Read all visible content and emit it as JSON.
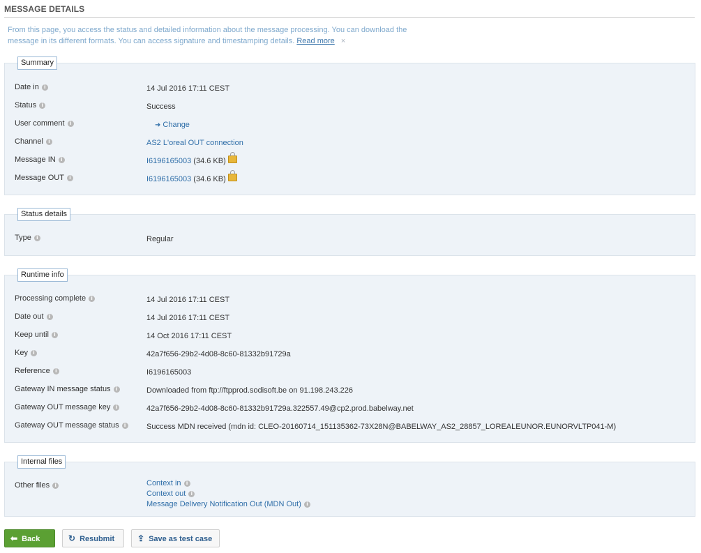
{
  "page": {
    "title": "MESSAGE DETAILS",
    "intro_text": "From this page, you access the status and detailed information about the message processing. You can download the message in its different formats. You can access signature and timestamping details.",
    "read_more": "Read more",
    "close_symbol": "×"
  },
  "summary": {
    "legend": "Summary",
    "date_in_label": "Date in",
    "date_in_value": "14 Jul 2016 17:11 CEST",
    "status_label": "Status",
    "status_value": "Success",
    "user_comment_label": "User comment",
    "change_label": "Change",
    "channel_label": "Channel",
    "channel_value": "AS2 L'oreal OUT connection",
    "message_in_label": "Message IN",
    "message_in_id": "I6196165003",
    "message_in_size": "(34.6 KB)",
    "message_out_label": "Message OUT",
    "message_out_id": "I6196165003",
    "message_out_size": "(34.6 KB)"
  },
  "status_details": {
    "legend": "Status details",
    "type_label": "Type",
    "type_value": "Regular"
  },
  "runtime": {
    "legend": "Runtime info",
    "processing_complete_label": "Processing complete",
    "processing_complete_value": "14 Jul 2016 17:11 CEST",
    "date_out_label": "Date out",
    "date_out_value": "14 Jul 2016 17:11 CEST",
    "keep_until_label": "Keep until",
    "keep_until_value": "14 Oct 2016 17:11 CEST",
    "key_label": "Key",
    "key_value": "42a7f656-29b2-4d08-8c60-81332b91729a",
    "reference_label": "Reference",
    "reference_value": "I6196165003",
    "gw_in_status_label": "Gateway IN message status",
    "gw_in_status_value": "Downloaded from ftp://ftpprod.sodisoft.be on 91.198.243.226",
    "gw_out_key_label": "Gateway OUT message key",
    "gw_out_key_value": "42a7f656-29b2-4d08-8c60-81332b91729a.322557.49@cp2.prod.babelway.net",
    "gw_out_status_label": "Gateway OUT message status",
    "gw_out_status_value": "Success MDN received (mdn id: CLEO-20160714_151135362-73X28N@BABELWAY_AS2_28857_LOREALEUNOR.EUNORVLTP041-M)"
  },
  "internal_files": {
    "legend": "Internal files",
    "other_files_label": "Other files",
    "context_in": "Context in",
    "context_out": "Context out",
    "mdn_out": "Message Delivery Notification Out (MDN Out)"
  },
  "buttons": {
    "back": "Back",
    "resubmit": "Resubmit",
    "save_test_case": "Save as test case"
  },
  "icons": {
    "info": "info-icon",
    "lock": "lock-icon",
    "arrow": "arrow-right-icon",
    "back": "back-arrow-icon",
    "refresh": "refresh-icon",
    "export": "export-icon"
  },
  "colors": {
    "link": "#2f6ea8",
    "intro": "#7fa9cd",
    "panel_bg": "#eef3f8",
    "primary_button": "#5ba033"
  }
}
